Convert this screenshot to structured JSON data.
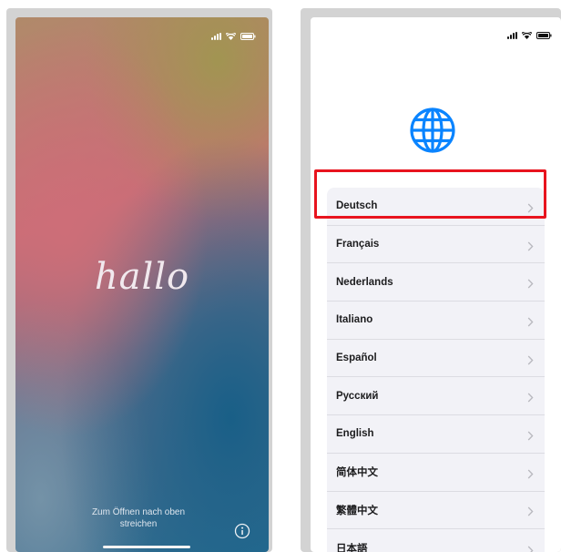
{
  "colors": {
    "frame": "#d3d3d3",
    "highlight_border": "#e8141e",
    "globe_blue": "#0a84ff",
    "list_background": "#f2f2f7",
    "chevron": "#b8b8be"
  },
  "left_phone": {
    "greeting": "hallo",
    "swipe_hint_line1": "Zum Öffnen nach oben",
    "swipe_hint_line2": "streichen",
    "status_icons": [
      "signal-icon",
      "wifi-icon",
      "battery-icon"
    ],
    "info_icon": "info-icon"
  },
  "right_phone": {
    "status_icons": [
      "signal-icon",
      "wifi-icon",
      "battery-icon"
    ],
    "header_icon": "globe-icon",
    "languages": [
      {
        "label": "Deutsch",
        "highlighted": true
      },
      {
        "label": "Français"
      },
      {
        "label": "Nederlands"
      },
      {
        "label": "Italiano"
      },
      {
        "label": "Español"
      },
      {
        "label": "Русский"
      },
      {
        "label": "English"
      },
      {
        "label": "简体中文"
      },
      {
        "label": "繁體中文"
      },
      {
        "label": "日本語"
      }
    ]
  }
}
